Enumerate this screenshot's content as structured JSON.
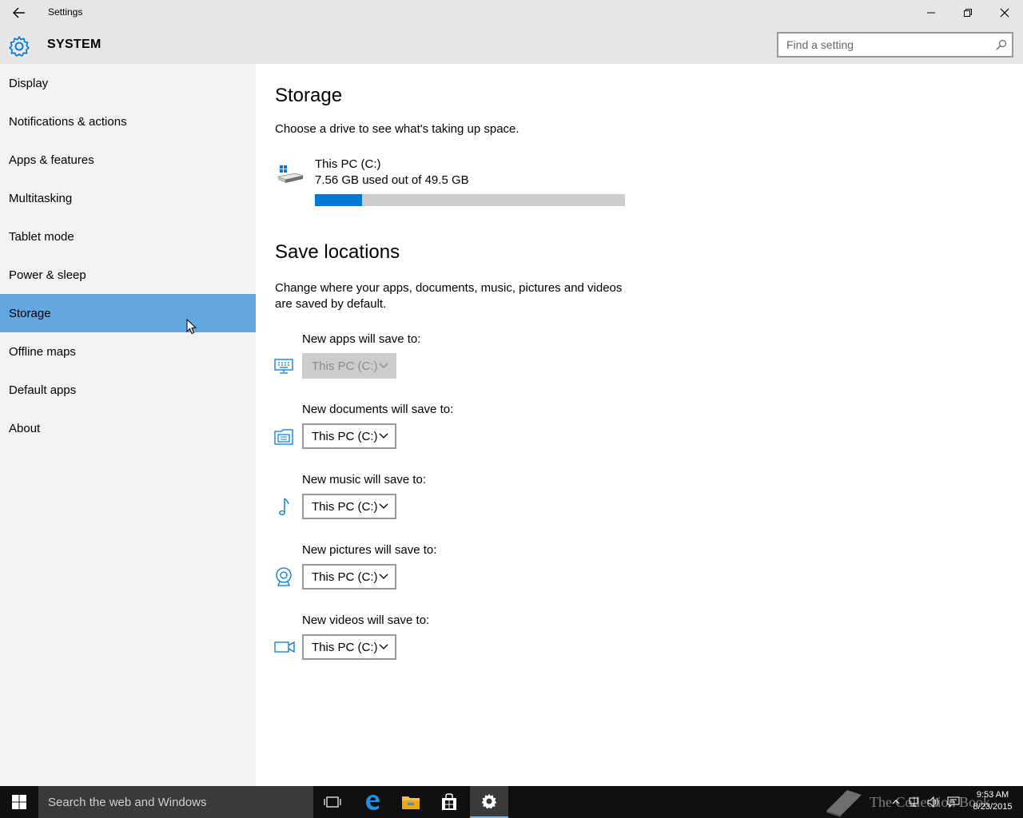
{
  "window": {
    "title": "Settings",
    "back_icon": "back-arrow-icon",
    "minimize_icon": "minimize-icon",
    "maximize_icon": "restore-icon",
    "close_icon": "close-icon"
  },
  "header": {
    "section": "SYSTEM",
    "icon": "gear-icon",
    "search_placeholder": "Find a setting"
  },
  "sidebar": {
    "items": [
      {
        "label": "Display"
      },
      {
        "label": "Notifications & actions"
      },
      {
        "label": "Apps & features"
      },
      {
        "label": "Multitasking"
      },
      {
        "label": "Tablet mode"
      },
      {
        "label": "Power & sleep"
      },
      {
        "label": "Storage"
      },
      {
        "label": "Offline maps"
      },
      {
        "label": "Default apps"
      },
      {
        "label": "About"
      }
    ],
    "selected": "Storage",
    "selected_color": "#63a7e0"
  },
  "storage": {
    "title": "Storage",
    "description": "Choose a drive to see what's taking up space.",
    "drive": {
      "name": "This PC (C:)",
      "usage_text": "7.56 GB used out of 49.5 GB",
      "used_gb": 7.56,
      "total_gb": 49.5,
      "bar_color": "#0078d7"
    }
  },
  "save_locations": {
    "title": "Save locations",
    "description": "Change where your apps, documents, music, pictures and videos are saved by default.",
    "items": [
      {
        "label": "New apps will save to:",
        "value": "This PC (C:)",
        "icon": "monitor-keyboard-icon",
        "disabled": true
      },
      {
        "label": "New documents will save to:",
        "value": "This PC (C:)",
        "icon": "document-folder-icon",
        "disabled": false
      },
      {
        "label": "New music will save to:",
        "value": "This PC (C:)",
        "icon": "music-note-icon",
        "disabled": false
      },
      {
        "label": "New pictures will save to:",
        "value": "This PC (C:)",
        "icon": "webcam-icon",
        "disabled": false
      },
      {
        "label": "New videos will save to:",
        "value": "This PC (C:)",
        "icon": "video-camera-icon",
        "disabled": false
      }
    ]
  },
  "taskbar": {
    "search_placeholder": "Search the web and Windows",
    "icons": [
      "windows-start-icon",
      "task-view-icon",
      "edge-icon",
      "file-explorer-icon",
      "store-icon",
      "settings-icon"
    ],
    "watermark": "The Collection Book",
    "time": "9:53 AM",
    "date": "8/23/2015"
  },
  "accent_color": "#0078d7"
}
